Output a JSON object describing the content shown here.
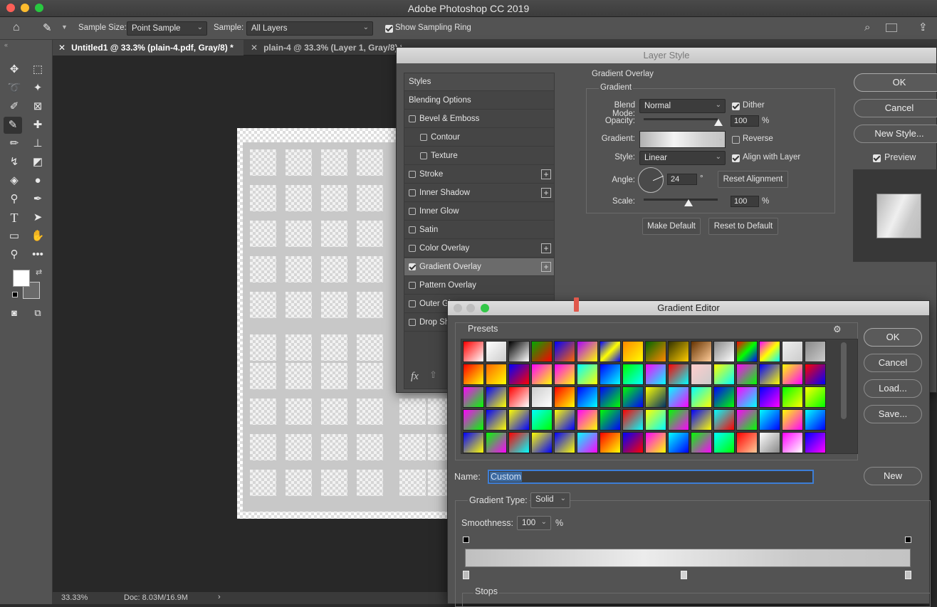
{
  "app": {
    "title": "Adobe Photoshop CC 2019"
  },
  "options": {
    "sample_size_label": "Sample Size:",
    "sample_size_value": "Point Sample",
    "sample_label": "Sample:",
    "sample_value": "All Layers",
    "show_ring_label": "Show Sampling Ring"
  },
  "tabs": [
    {
      "label": "Untitled1 @ 33.3% (plain-4.pdf, Gray/8) *"
    },
    {
      "label": "plain-4 @ 33.3% (Layer 1, Gray/8) *"
    }
  ],
  "status": {
    "zoom": "33.33%",
    "doc": "Doc: 8.03M/16.9M"
  },
  "layer_style": {
    "title": "Layer Style",
    "styles_header": "Styles",
    "items": [
      {
        "label": "Blending Options",
        "checkbox": false
      },
      {
        "label": "Bevel & Emboss",
        "checkbox": true,
        "checked": false
      },
      {
        "label": "Contour",
        "checkbox": true,
        "checked": false,
        "indent": true
      },
      {
        "label": "Texture",
        "checkbox": true,
        "checked": false,
        "indent": true
      },
      {
        "label": "Stroke",
        "checkbox": true,
        "checked": false,
        "plus": true
      },
      {
        "label": "Inner Shadow",
        "checkbox": true,
        "checked": false,
        "plus": true
      },
      {
        "label": "Inner Glow",
        "checkbox": true,
        "checked": false
      },
      {
        "label": "Satin",
        "checkbox": true,
        "checked": false
      },
      {
        "label": "Color Overlay",
        "checkbox": true,
        "checked": false,
        "plus": true
      },
      {
        "label": "Gradient Overlay",
        "checkbox": true,
        "checked": true,
        "plus": true,
        "selected": true
      },
      {
        "label": "Pattern Overlay",
        "checkbox": true,
        "checked": false
      },
      {
        "label": "Outer Gl",
        "checkbox": true,
        "checked": false
      },
      {
        "label": "Drop Sha",
        "checkbox": true,
        "checked": false
      }
    ],
    "fx": "fx",
    "section_title": "Gradient Overlay",
    "group_title": "Gradient",
    "blend_mode_label": "Blend Mode:",
    "blend_mode": "Normal",
    "dither_label": "Dither",
    "opacity_label": "Opacity:",
    "opacity": "100",
    "pct": "%",
    "gradient_label": "Gradient:",
    "reverse_label": "Reverse",
    "style_label": "Style:",
    "style": "Linear",
    "align_label": "Align with Layer",
    "angle_label": "Angle:",
    "angle": "24",
    "deg": "°",
    "reset_alignment": "Reset Alignment",
    "scale_label": "Scale:",
    "scale": "100",
    "make_default": "Make Default",
    "reset_default": "Reset to Default",
    "ok": "OK",
    "cancel": "Cancel",
    "new_style": "New Style...",
    "preview_label": "Preview"
  },
  "gradient_editor": {
    "title": "Gradient Editor",
    "presets_label": "Presets",
    "ok": "OK",
    "cancel": "Cancel",
    "load": "Load...",
    "save": "Save...",
    "name_label": "Name:",
    "name_value": "Custom",
    "new": "New",
    "type_label": "Gradient Type:",
    "type_value": "Solid",
    "smoothness_label": "Smoothness:",
    "smoothness_value": "100",
    "pct": "%",
    "stops_label": "Stops"
  },
  "colors": {
    "accent": "#3d7ed6",
    "panel": "#535353"
  }
}
